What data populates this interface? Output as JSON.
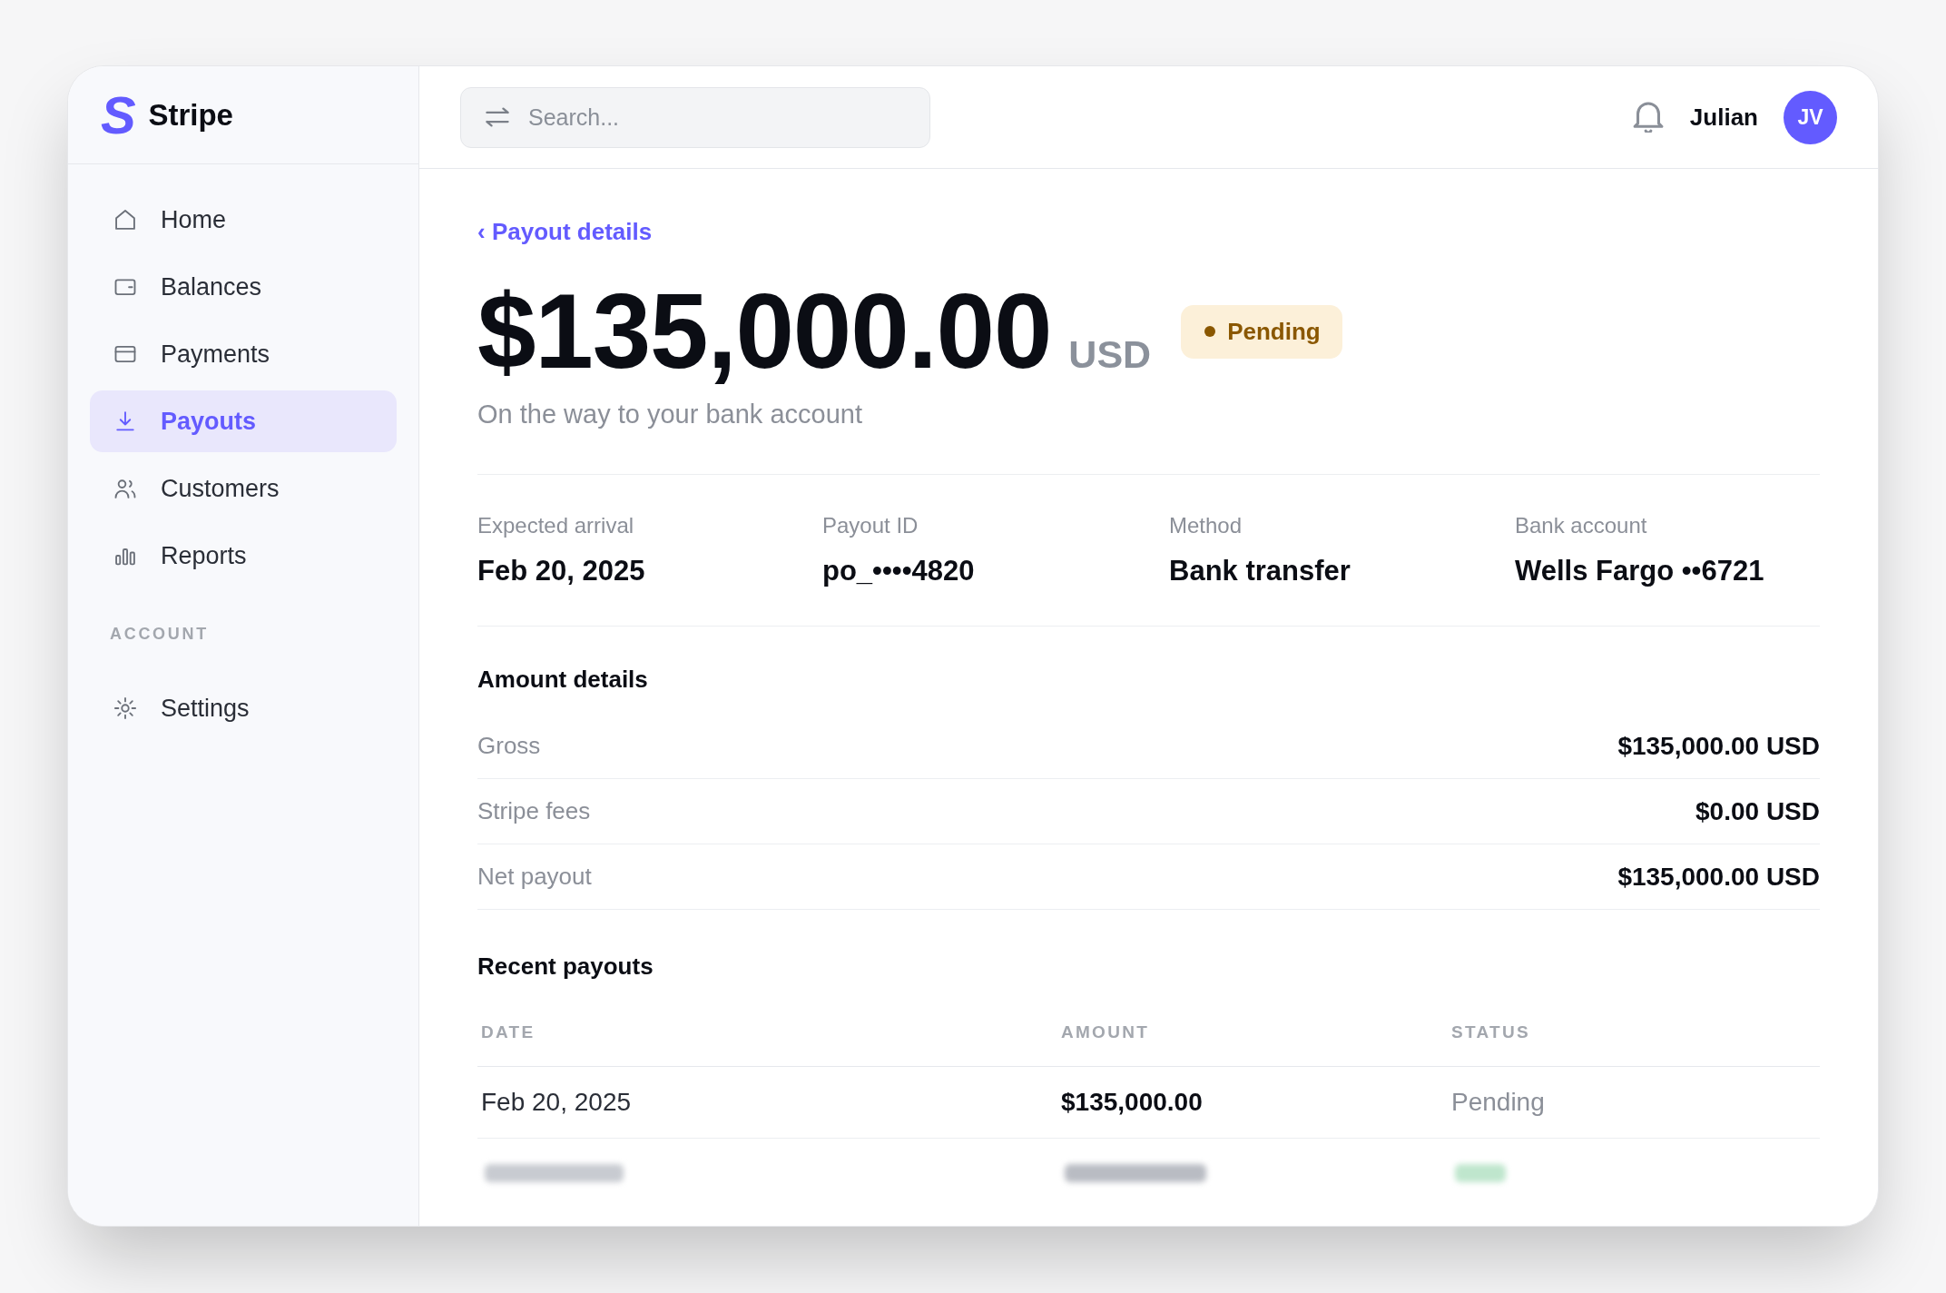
{
  "sidebar": {
    "brand": {
      "mark": "S",
      "name": "Stripe"
    },
    "items": [
      {
        "label": "Home",
        "selected": false
      },
      {
        "label": "Balances",
        "selected": false
      },
      {
        "label": "Payments",
        "selected": false
      },
      {
        "label": "Payouts",
        "selected": true
      },
      {
        "label": "Customers",
        "selected": false
      },
      {
        "label": "Reports",
        "selected": false
      }
    ],
    "sections": [
      {
        "title": "ACCOUNT",
        "items": [
          {
            "label": "Settings",
            "selected": false
          }
        ]
      }
    ]
  },
  "header": {
    "search": {
      "placeholder": "Search..."
    },
    "user": {
      "name": "Julian",
      "initials": "JV"
    }
  },
  "payout": {
    "back_link": "‹ Payout details",
    "amount": "$135,000.00",
    "currency": "USD",
    "status": {
      "label": "Pending"
    },
    "subtitle": "On the way to your bank account",
    "facts": [
      {
        "label": "Expected arrival",
        "value": "Feb 20, 2025"
      },
      {
        "label": "Payout ID",
        "value": "po_••••4820"
      },
      {
        "label": "Method",
        "value": "Bank transfer"
      },
      {
        "label": "Bank account",
        "value": "Wells Fargo ••6721"
      }
    ]
  },
  "amount_details": {
    "title": "Amount details",
    "rows": [
      {
        "label": "Gross",
        "value": "$135,000.00 USD"
      },
      {
        "label": "Stripe fees",
        "value": "$0.00 USD"
      },
      {
        "label": "Net payout",
        "value": "$135,000.00 USD"
      }
    ]
  },
  "recent_payouts": {
    "title": "Recent payouts",
    "columns": [
      "DATE",
      "AMOUNT",
      "STATUS"
    ],
    "rows": [
      {
        "date": "Feb 20, 2025",
        "amount": "$135,000.00",
        "status": "Pending"
      }
    ],
    "more_rows_blurred": true
  }
}
